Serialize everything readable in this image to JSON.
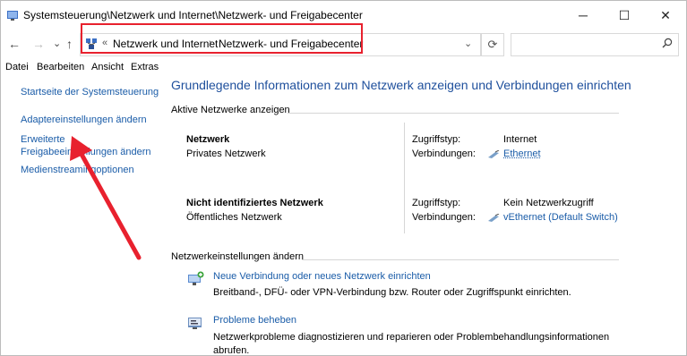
{
  "window": {
    "title": "Systemsteuerung\\Netzwerk und Internet\\Netzwerk- und Freigabecenter",
    "minimize": "─",
    "maximize": "☐",
    "close": "✕"
  },
  "nav": {
    "back": "←",
    "forward": "→",
    "recent": "⌄",
    "up": "↑"
  },
  "address": {
    "overflow": "«",
    "crumbs": [
      "Netzwerk und Internet",
      "Netzwerk- und Freigabecenter"
    ],
    "separator": "›",
    "dropdown": "⌄"
  },
  "refresh": "⟳",
  "search": {
    "placeholder": ""
  },
  "menu": [
    "Datei",
    "Bearbeiten",
    "Ansicht",
    "Extras"
  ],
  "sidebar": {
    "home": "Startseite der Systemsteuerung",
    "adapter": "Adaptereinstellungen ändern",
    "advanced_line1": "Erweiterte",
    "advanced_line2": "Freigabeeinstellungen ändern",
    "media": "Medienstreamingoptionen"
  },
  "main": {
    "heading": "Grundlegende Informationen zum Netzwerk anzeigen und Verbindungen einrichten",
    "active_title": "Aktive Netzwerke anzeigen",
    "networks": [
      {
        "name": "Netzwerk",
        "type": "Privates Netzwerk",
        "access_label": "Zugriffstyp:",
        "access_value": "Internet",
        "conn_label": "Verbindungen:",
        "conn_value": "Ethernet"
      },
      {
        "name": "Nicht identifiziertes Netzwerk",
        "type": "Öffentliches Netzwerk",
        "access_label": "Zugriffstyp:",
        "access_value": "Kein Netzwerkzugriff",
        "conn_label": "Verbindungen:",
        "conn_value": "vEthernet (Default Switch)"
      }
    ],
    "settings_title": "Netzwerkeinstellungen ändern",
    "tasks": [
      {
        "link": "Neue Verbindung oder neues Netzwerk einrichten",
        "desc": "Breitband-, DFÜ- oder VPN-Verbindung bzw. Router oder Zugriffspunkt einrichten."
      },
      {
        "link": "Probleme beheben",
        "desc": "Netzwerkprobleme diagnostizieren und reparieren oder Problembehandlungsinformationen abrufen."
      }
    ]
  },
  "colors": {
    "accent": "#1a5ca8",
    "heading": "#1e4f9c",
    "annotation": "#e8212e"
  }
}
